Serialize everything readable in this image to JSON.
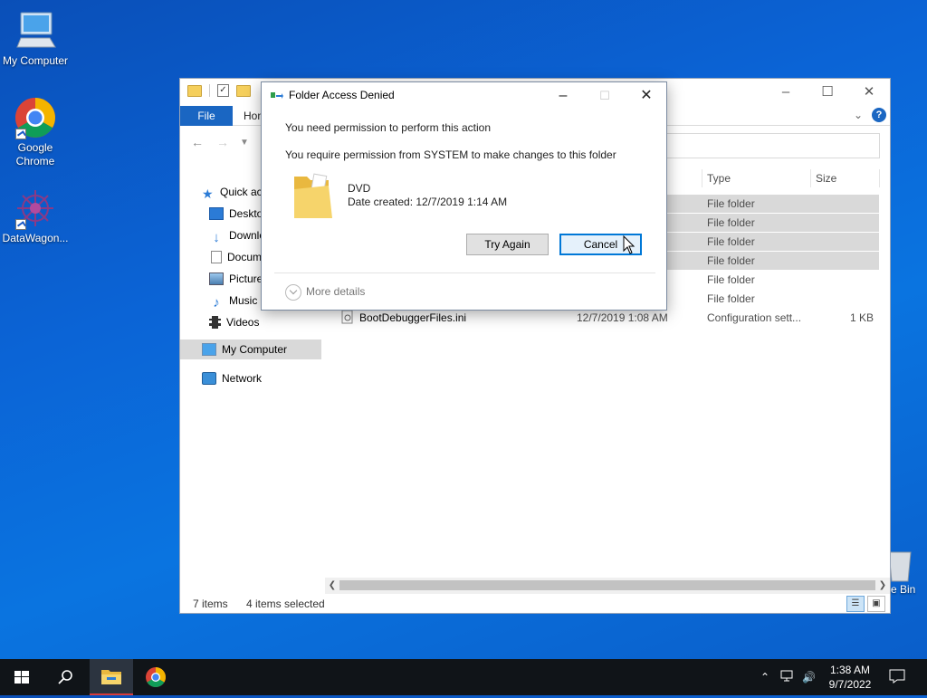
{
  "desktop": {
    "icons": [
      {
        "label": "My Computer"
      },
      {
        "label": "Google Chrome"
      },
      {
        "label": "DataWagon..."
      },
      {
        "label": "e Bin"
      }
    ]
  },
  "explorer": {
    "tabs": {
      "file": "File",
      "home": "Hon"
    },
    "nav": {
      "quick_access": "Quick ac",
      "desktop": "Deskto",
      "downloads": "Downlo",
      "documents": "Docum",
      "pictures": "Picture",
      "music": "Music",
      "videos": "Videos",
      "my_computer": "My Computer",
      "network": "Network"
    },
    "columns": {
      "type": "Type",
      "size": "Size"
    },
    "rows": [
      {
        "type": "File folder",
        "selected": true
      },
      {
        "type": "File folder",
        "selected": true
      },
      {
        "type": "File folder",
        "selected": true
      },
      {
        "type": "File folder",
        "selected": true
      },
      {
        "type": "File folder",
        "selected": false
      },
      {
        "type": "File folder",
        "selected": false
      }
    ],
    "file": {
      "name": "BootDebuggerFiles.ini",
      "date": "12/7/2019 1:08 AM",
      "type": "Configuration sett...",
      "size": "1 KB"
    },
    "status": {
      "items": "7 items",
      "selected": "4 items selected"
    }
  },
  "dialog": {
    "title": "Folder Access Denied",
    "line1": "You need permission to perform this action",
    "line2": "You require permission from SYSTEM to make changes to this folder",
    "folder_name": "DVD",
    "folder_date": "Date created: 12/7/2019 1:14 AM",
    "try_again": "Try Again",
    "cancel": "Cancel",
    "more_details": "More details"
  },
  "taskbar": {
    "time": "1:38 AM",
    "date": "9/7/2022"
  },
  "colors": {
    "accent": "#1a66c2",
    "selection": "#d9d9d9",
    "taskbar": "#101418"
  }
}
